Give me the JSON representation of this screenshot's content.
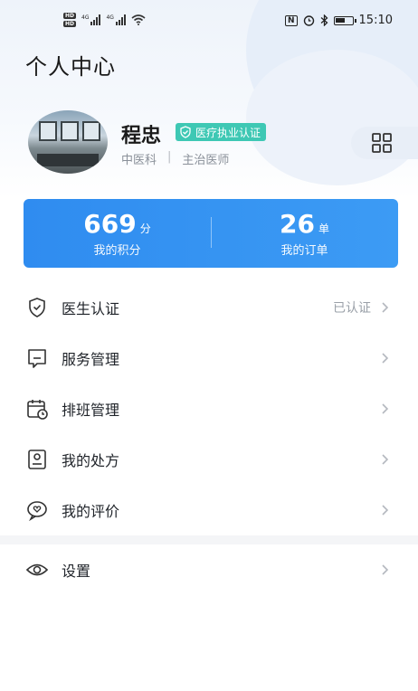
{
  "status_bar": {
    "hd1": "HD",
    "hd2": "HD",
    "net1": "4G",
    "net2": "4G",
    "nfc": "N",
    "time": "15:10"
  },
  "page": {
    "title": "个人中心"
  },
  "profile": {
    "name": "程忠",
    "badge": "医疗执业认证",
    "department": "中医科",
    "separator": "|",
    "position": "主治医师"
  },
  "stats": {
    "points_value": "669",
    "points_unit": "分",
    "points_label": "我的积分",
    "orders_value": "26",
    "orders_unit": "单",
    "orders_label": "我的订单"
  },
  "menu": {
    "items": [
      {
        "label": "医生认证",
        "value": "已认证",
        "icon": "shield-check-icon"
      },
      {
        "label": "服务管理",
        "value": "",
        "icon": "chat-bubble-icon"
      },
      {
        "label": "排班管理",
        "value": "",
        "icon": "calendar-clock-icon"
      },
      {
        "label": "我的处方",
        "value": "",
        "icon": "prescription-icon"
      },
      {
        "label": "我的评价",
        "value": "",
        "icon": "heart-comment-icon"
      }
    ],
    "settings": {
      "label": "设置",
      "icon": "eye-icon"
    }
  },
  "colors": {
    "accent": "#2f8cf0",
    "badge": "#3ec8b4",
    "text_secondary": "#8a9099"
  }
}
